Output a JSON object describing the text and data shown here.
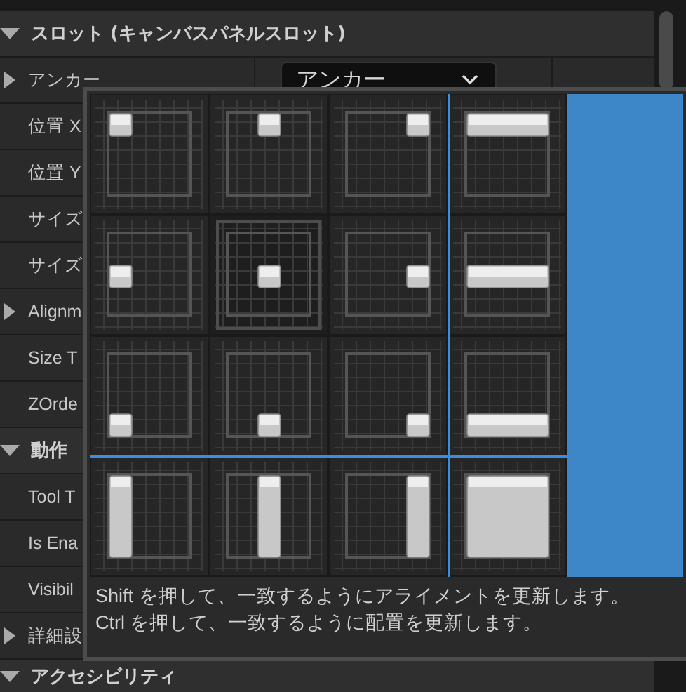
{
  "details_panel": {
    "rows": [
      {
        "kind": "section",
        "label": "スロット (キャンバスパネルスロット)",
        "expanded": true
      },
      {
        "kind": "group",
        "label": "アンカー",
        "expanded": false,
        "value": "アンカー"
      },
      {
        "kind": "property",
        "label": "位置 X"
      },
      {
        "kind": "property",
        "label": "位置 Y"
      },
      {
        "kind": "property",
        "label": "サイズ"
      },
      {
        "kind": "property",
        "label": "サイズ"
      },
      {
        "kind": "group",
        "label": "Alignm",
        "expanded": false
      },
      {
        "kind": "property",
        "label": "Size T"
      },
      {
        "kind": "property",
        "label": "ZOrde"
      },
      {
        "kind": "section",
        "label": "動作",
        "expanded": true
      },
      {
        "kind": "property",
        "label": "Tool T"
      },
      {
        "kind": "property",
        "label": "Is Ena"
      },
      {
        "kind": "property",
        "label": "Visibil"
      },
      {
        "kind": "group",
        "label": "詳細設",
        "expanded": false
      },
      {
        "kind": "section",
        "label": "アクセシビリティ",
        "expanded": true
      }
    ]
  },
  "anchor_popup": {
    "presets": [
      {
        "kind": "topleft",
        "highlighted": false
      },
      {
        "kind": "topcenter",
        "highlighted": false
      },
      {
        "kind": "topright",
        "highlighted": false
      },
      {
        "kind": "topstretch",
        "highlighted": false
      },
      {
        "kind": "centerleft",
        "highlighted": false
      },
      {
        "kind": "centercenter",
        "highlighted": true
      },
      {
        "kind": "centerright",
        "highlighted": false
      },
      {
        "kind": "centerstretch",
        "highlighted": false
      },
      {
        "kind": "bottomleft",
        "highlighted": false
      },
      {
        "kind": "bottomcenter",
        "highlighted": false
      },
      {
        "kind": "bottomright",
        "highlighted": false
      },
      {
        "kind": "bottomstretch",
        "highlighted": false
      },
      {
        "kind": "stretchleft",
        "highlighted": false
      },
      {
        "kind": "stretchcenter",
        "highlighted": false
      },
      {
        "kind": "stretchright",
        "highlighted": false
      },
      {
        "kind": "stretchstretch",
        "highlighted": false
      }
    ],
    "hint_lines": [
      "Shift を押して、一致するようにアライメントを更新します。",
      "Ctrl を押して、一致するように配置を更新します。"
    ]
  }
}
